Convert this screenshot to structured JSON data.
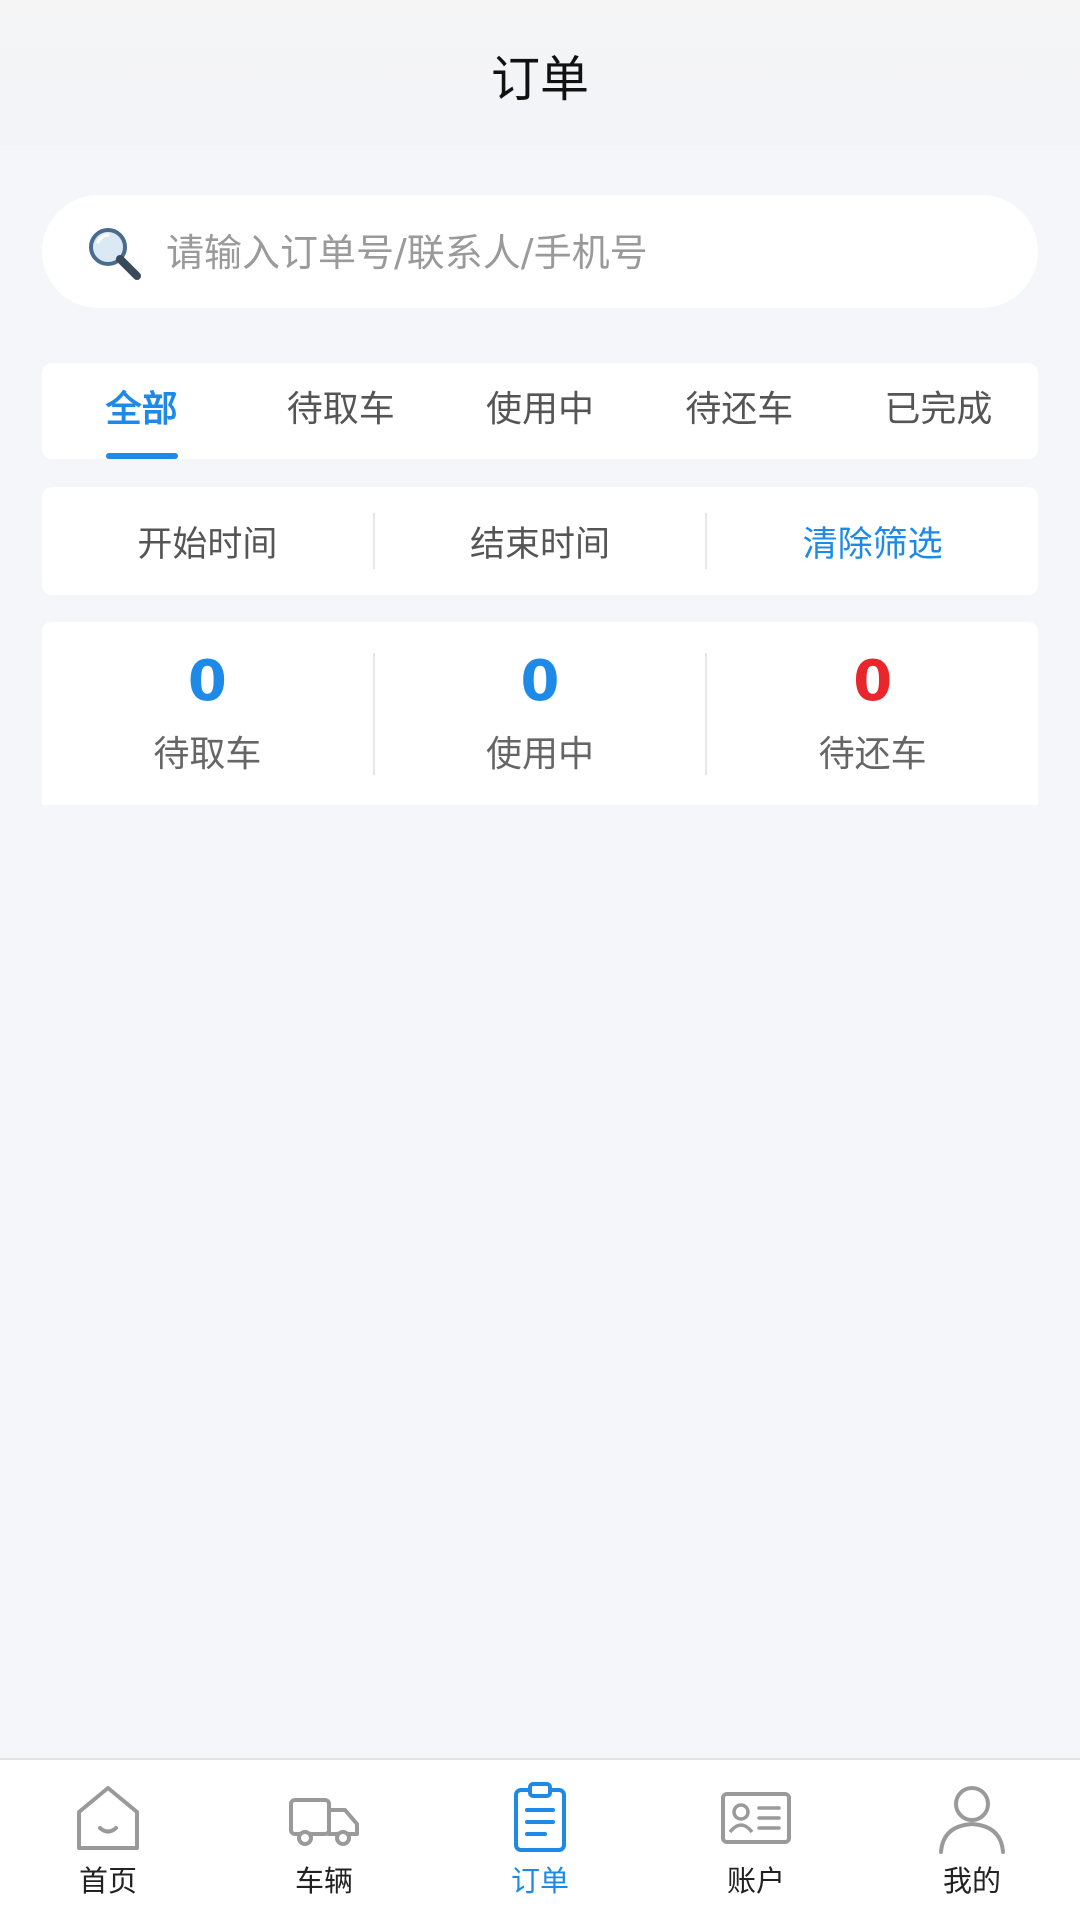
{
  "header": {
    "title": "订单"
  },
  "search": {
    "placeholder": "请输入订单号/联系人/手机号",
    "icon": "search-icon"
  },
  "tabs": [
    {
      "label": "全部",
      "active": true
    },
    {
      "label": "待取车"
    },
    {
      "label": "使用中"
    },
    {
      "label": "待还车"
    },
    {
      "label": "已完成"
    }
  ],
  "filters": {
    "start_label": "开始时间",
    "end_label": "结束时间",
    "clear_label": "清除筛选"
  },
  "stats": [
    {
      "value": "0",
      "label": "待取车",
      "color": "#1e8ae8"
    },
    {
      "value": "0",
      "label": "使用中",
      "color": "#1e8ae8"
    },
    {
      "value": "0",
      "label": "待还车",
      "color": "#e8262c"
    }
  ],
  "tabbar": [
    {
      "label": "首页",
      "icon": "home-icon"
    },
    {
      "label": "车辆",
      "icon": "truck-icon"
    },
    {
      "label": "订单",
      "icon": "clipboard-icon",
      "active": true
    },
    {
      "label": "账户",
      "icon": "id-card-icon"
    },
    {
      "label": "我的",
      "icon": "user-icon"
    }
  ],
  "colors": {
    "accent": "#1e8ae8",
    "alert": "#e8262c",
    "background": "#f4f6fa"
  }
}
